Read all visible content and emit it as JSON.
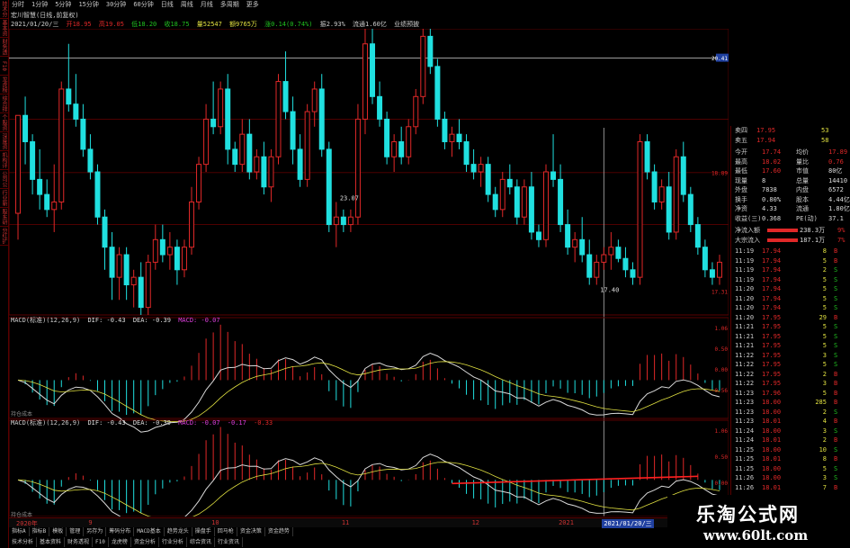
{
  "period_tabs": [
    "分时",
    "1分钟",
    "5分钟",
    "15分钟",
    "30分钟",
    "60分钟",
    "日线",
    "周线",
    "月线",
    "多周期",
    "更多"
  ],
  "left_tabs": [
    "技术分析",
    "基本资料",
    "财务透视",
    "F10",
    "龙虎榜单",
    "综合排名",
    "个股资讯",
    "深度资料",
    "机构评级",
    "公司公告",
    "行业新闻",
    "股东研究",
    "分红扩股"
  ],
  "chart_title": "宏川智慧(日线,前复权)",
  "info_line": {
    "date": "2021/01/20/三",
    "open": "开18.95",
    "high": "高19.05",
    "low": "低18.20",
    "close": "收18.75",
    "volume": "量52547",
    "amount": "额9765万",
    "change": "涨0.14(0.74%)",
    "amplitude": "振2.93%",
    "float": "流通1.60亿",
    "other": "业绩预披"
  },
  "colors": {
    "up": "#e02828",
    "down": "#20e0e0",
    "bg": "#000000",
    "grid": "#5a0000",
    "dif": "#d8d8d8",
    "dea": "#f0f0f0",
    "panel_bg": "#000000"
  },
  "chart_data": [
    {
      "type": "candlestick",
      "name": "price",
      "candles": [
        {
          "o": 18.35,
          "h": 19.5,
          "l": 18.0,
          "c": 19.65
        },
        {
          "o": 19.65,
          "h": 19.9,
          "l": 19.0,
          "c": 19.3
        },
        {
          "o": 19.3,
          "h": 19.4,
          "l": 18.6,
          "c": 18.8
        },
        {
          "o": 18.8,
          "h": 19.2,
          "l": 18.4,
          "c": 18.6
        },
        {
          "o": 18.6,
          "h": 18.8,
          "l": 18.3,
          "c": 18.4
        },
        {
          "o": 18.4,
          "h": 19.0,
          "l": 18.1,
          "c": 18.5
        },
        {
          "o": 18.5,
          "h": 20.1,
          "l": 18.4,
          "c": 20.0
        },
        {
          "o": 20.0,
          "h": 20.6,
          "l": 19.7,
          "c": 19.8
        },
        {
          "o": 19.8,
          "h": 20.2,
          "l": 19.5,
          "c": 19.6
        },
        {
          "o": 19.6,
          "h": 19.8,
          "l": 19.1,
          "c": 19.2
        },
        {
          "o": 19.2,
          "h": 19.4,
          "l": 18.8,
          "c": 18.9
        },
        {
          "o": 18.9,
          "h": 19.0,
          "l": 18.2,
          "c": 18.3
        },
        {
          "o": 18.3,
          "h": 18.4,
          "l": 17.6,
          "c": 17.9
        },
        {
          "o": 17.9,
          "h": 18.1,
          "l": 17.2,
          "c": 17.5
        },
        {
          "o": 17.5,
          "h": 17.9,
          "l": 17.2,
          "c": 17.8
        },
        {
          "o": 17.8,
          "h": 17.9,
          "l": 17.2,
          "c": 17.4
        },
        {
          "o": 17.4,
          "h": 17.6,
          "l": 17.1,
          "c": 17.5
        },
        {
          "o": 17.5,
          "h": 17.7,
          "l": 17.0,
          "c": 17.1
        },
        {
          "o": 17.1,
          "h": 17.8,
          "l": 17.0,
          "c": 17.7
        },
        {
          "o": 17.7,
          "h": 18.2,
          "l": 17.6,
          "c": 18.0
        },
        {
          "o": 18.0,
          "h": 18.2,
          "l": 17.7,
          "c": 17.8
        },
        {
          "o": 17.8,
          "h": 18.1,
          "l": 17.6,
          "c": 17.9
        },
        {
          "o": 17.9,
          "h": 18.0,
          "l": 17.4,
          "c": 17.6
        },
        {
          "o": 17.6,
          "h": 18.0,
          "l": 17.5,
          "c": 17.9
        },
        {
          "o": 17.9,
          "h": 18.7,
          "l": 17.8,
          "c": 18.5
        },
        {
          "o": 18.5,
          "h": 19.1,
          "l": 18.4,
          "c": 19.0
        },
        {
          "o": 19.0,
          "h": 19.8,
          "l": 18.9,
          "c": 19.6
        },
        {
          "o": 19.6,
          "h": 20.1,
          "l": 19.4,
          "c": 19.5
        },
        {
          "o": 19.5,
          "h": 20.1,
          "l": 19.4,
          "c": 20.0
        },
        {
          "o": 20.0,
          "h": 20.2,
          "l": 19.0,
          "c": 19.2
        },
        {
          "o": 19.2,
          "h": 19.3,
          "l": 18.9,
          "c": 19.0
        },
        {
          "o": 19.0,
          "h": 19.6,
          "l": 18.9,
          "c": 19.4
        },
        {
          "o": 19.4,
          "h": 19.6,
          "l": 18.8,
          "c": 18.9
        },
        {
          "o": 18.9,
          "h": 19.2,
          "l": 18.8,
          "c": 19.1
        },
        {
          "o": 19.1,
          "h": 19.3,
          "l": 18.6,
          "c": 18.7
        },
        {
          "o": 18.7,
          "h": 19.2,
          "l": 18.5,
          "c": 19.1
        },
        {
          "o": 19.1,
          "h": 20.2,
          "l": 19.0,
          "c": 20.1
        },
        {
          "o": 20.1,
          "h": 20.5,
          "l": 19.6,
          "c": 19.7
        },
        {
          "o": 19.7,
          "h": 19.9,
          "l": 19.0,
          "c": 19.2
        },
        {
          "o": 19.2,
          "h": 19.4,
          "l": 18.7,
          "c": 18.8
        },
        {
          "o": 18.8,
          "h": 19.8,
          "l": 18.7,
          "c": 19.7
        },
        {
          "o": 19.7,
          "h": 20.1,
          "l": 19.5,
          "c": 20.0
        },
        {
          "o": 20.0,
          "h": 20.2,
          "l": 19.1,
          "c": 19.2
        },
        {
          "o": 19.2,
          "h": 19.3,
          "l": 18.1,
          "c": 18.2
        },
        {
          "o": 18.2,
          "h": 18.5,
          "l": 17.9,
          "c": 18.3
        },
        {
          "o": 18.3,
          "h": 18.4,
          "l": 18.1,
          "c": 18.2
        },
        {
          "o": 18.2,
          "h": 18.4,
          "l": 18.1,
          "c": 18.3
        },
        {
          "o": 18.3,
          "h": 19.8,
          "l": 18.2,
          "c": 19.6
        },
        {
          "o": 19.6,
          "h": 21.0,
          "l": 19.4,
          "c": 20.6
        },
        {
          "o": 20.6,
          "h": 21.2,
          "l": 19.8,
          "c": 19.9
        },
        {
          "o": 19.9,
          "h": 20.1,
          "l": 19.5,
          "c": 19.6
        },
        {
          "o": 19.6,
          "h": 19.7,
          "l": 19.0,
          "c": 19.1
        },
        {
          "o": 19.1,
          "h": 19.4,
          "l": 18.9,
          "c": 19.3
        },
        {
          "o": 19.3,
          "h": 19.5,
          "l": 19.0,
          "c": 19.1
        },
        {
          "o": 19.1,
          "h": 19.6,
          "l": 19.0,
          "c": 19.5
        },
        {
          "o": 19.5,
          "h": 20.0,
          "l": 19.4,
          "c": 19.9
        },
        {
          "o": 19.9,
          "h": 20.9,
          "l": 19.8,
          "c": 20.7
        },
        {
          "o": 20.7,
          "h": 20.8,
          "l": 20.2,
          "c": 20.3
        },
        {
          "o": 20.3,
          "h": 20.4,
          "l": 19.5,
          "c": 19.6
        },
        {
          "o": 19.6,
          "h": 19.7,
          "l": 19.2,
          "c": 19.3
        },
        {
          "o": 19.3,
          "h": 19.5,
          "l": 19.1,
          "c": 19.4
        },
        {
          "o": 19.4,
          "h": 19.6,
          "l": 19.2,
          "c": 19.3
        },
        {
          "o": 19.3,
          "h": 19.4,
          "l": 18.9,
          "c": 19.0
        },
        {
          "o": 19.0,
          "h": 19.2,
          "l": 18.8,
          "c": 18.9
        },
        {
          "o": 18.9,
          "h": 19.1,
          "l": 18.7,
          "c": 19.0
        },
        {
          "o": 19.0,
          "h": 19.1,
          "l": 18.5,
          "c": 18.6
        },
        {
          "o": 18.6,
          "h": 18.7,
          "l": 18.3,
          "c": 18.4
        },
        {
          "o": 18.4,
          "h": 18.9,
          "l": 18.3,
          "c": 18.8
        },
        {
          "o": 18.8,
          "h": 19.0,
          "l": 18.6,
          "c": 18.7
        },
        {
          "o": 18.7,
          "h": 18.8,
          "l": 18.2,
          "c": 18.3
        },
        {
          "o": 18.3,
          "h": 18.8,
          "l": 18.2,
          "c": 18.7
        },
        {
          "o": 18.7,
          "h": 18.9,
          "l": 18.0,
          "c": 18.1
        },
        {
          "o": 18.1,
          "h": 18.2,
          "l": 17.9,
          "c": 18.0
        },
        {
          "o": 18.0,
          "h": 19.0,
          "l": 17.9,
          "c": 18.9
        },
        {
          "o": 18.9,
          "h": 19.4,
          "l": 18.7,
          "c": 18.8
        },
        {
          "o": 18.8,
          "h": 19.0,
          "l": 18.1,
          "c": 18.2
        },
        {
          "o": 18.2,
          "h": 18.4,
          "l": 17.8,
          "c": 17.9
        },
        {
          "o": 17.9,
          "h": 18.1,
          "l": 17.7,
          "c": 18.0
        },
        {
          "o": 18.0,
          "h": 18.3,
          "l": 17.7,
          "c": 17.8
        },
        {
          "o": 17.8,
          "h": 18.0,
          "l": 17.4,
          "c": 17.5
        },
        {
          "o": 17.5,
          "h": 17.8,
          "l": 17.4,
          "c": 17.7
        },
        {
          "o": 17.7,
          "h": 17.9,
          "l": 17.6,
          "c": 17.8
        },
        {
          "o": 17.8,
          "h": 18.1,
          "l": 17.6,
          "c": 17.9
        },
        {
          "o": 17.9,
          "h": 18.0,
          "l": 17.7,
          "c": 17.75
        },
        {
          "o": 17.75,
          "h": 17.9,
          "l": 17.5,
          "c": 17.6
        },
        {
          "o": 17.6,
          "h": 17.7,
          "l": 17.4,
          "c": 17.5
        },
        {
          "o": 17.5,
          "h": 19.4,
          "l": 17.4,
          "c": 19.3
        },
        {
          "o": 19.3,
          "h": 19.4,
          "l": 18.8,
          "c": 18.9
        },
        {
          "o": 18.9,
          "h": 19.0,
          "l": 18.4,
          "c": 18.5
        },
        {
          "o": 18.5,
          "h": 18.8,
          "l": 18.4,
          "c": 18.7
        },
        {
          "o": 18.7,
          "h": 18.9,
          "l": 18.0,
          "c": 18.1
        },
        {
          "o": 18.1,
          "h": 19.2,
          "l": 18.0,
          "c": 19.1
        },
        {
          "o": 19.1,
          "h": 19.3,
          "l": 18.5,
          "c": 18.6
        },
        {
          "o": 18.6,
          "h": 18.7,
          "l": 18.1,
          "c": 18.2
        },
        {
          "o": 18.2,
          "h": 18.3,
          "l": 17.8,
          "c": 17.9
        },
        {
          "o": 17.9,
          "h": 18.0,
          "l": 17.5,
          "c": 17.6
        },
        {
          "o": 17.6,
          "h": 17.7,
          "l": 17.4,
          "c": 17.5
        },
        {
          "o": 17.5,
          "h": 17.8,
          "l": 17.4,
          "c": 17.7
        }
      ],
      "ylim": [
        17.0,
        20.8
      ],
      "markers": [
        {
          "label": "23.07",
          "idx": 44
        },
        {
          "label": "17.40",
          "idx": 80
        }
      ],
      "axis_labels": [
        {
          "label": "20.41",
          "v": 20.41,
          "highlight": true
        },
        {
          "label": "18.89",
          "v": 18.89
        },
        {
          "label": "17.31",
          "v": 17.31
        }
      ],
      "hline": 20.41
    },
    {
      "type": "bar",
      "name": "macd1",
      "label": "MACD(标准)(12,26,9)",
      "dif": "DIF: -0.43",
      "dea": "DEA: -0.39",
      "macd": "MACD: -0.07",
      "ylim": [
        -1.0,
        1.6
      ],
      "ticks": [
        "1.06",
        "0.50",
        "0.00",
        "-0.56"
      ]
    },
    {
      "type": "bar",
      "name": "macd2",
      "label": "MACD(标准)(12,26,9)",
      "dif": "DIF: -0.43",
      "dea": "DEA: -0.39",
      "macd": "MACD: -0.07",
      "extra1": "-0.17",
      "extra2": "-0.33",
      "ylim": [
        -1.0,
        1.6
      ],
      "ticks": [
        "1.06",
        "0.50",
        "0.00"
      ]
    }
  ],
  "x_labels": [
    {
      "label": "2020年",
      "idx": 0
    },
    {
      "label": "9",
      "idx": 10
    },
    {
      "label": "10",
      "idx": 27
    },
    {
      "label": "11",
      "idx": 45
    },
    {
      "label": "12",
      "idx": 63
    },
    {
      "label": "2021",
      "idx": 75
    },
    {
      "label": "2021/01/20/三",
      "idx": 81
    }
  ],
  "macd_notes": [
    "持仓成本",
    "持仓成本"
  ],
  "quote": {
    "sell4": {
      "label": "卖四",
      "price": "17.95",
      "vol": "53"
    },
    "sell5": {
      "label": "卖五",
      "price": "17.94",
      "vol": "58"
    },
    "rows": [
      {
        "l1": "今开",
        "v1": "17.74",
        "l2": "均价",
        "v2": "17.89"
      },
      {
        "l1": "最高",
        "v1": "18.02",
        "l2": "量比",
        "v2": "0.76"
      },
      {
        "l1": "最低",
        "v1": "17.60",
        "l2": "市值",
        "v2": "80亿"
      },
      {
        "l1": "现量",
        "v1": "8",
        "l2": "总量",
        "v2": "14410"
      },
      {
        "l1": "外盘",
        "v1": "7838",
        "l2": "内盘",
        "v2": "6572"
      },
      {
        "l1": "换手",
        "v1": "0.80%",
        "l2": "股本",
        "v2": "4.44亿"
      },
      {
        "l1": "净资",
        "v1": "4.33",
        "l2": "流通",
        "v2": "1.80亿"
      },
      {
        "l1": "收益(三)",
        "v1": "0.368",
        "l2": "PE(动)",
        "v2": "37.1"
      }
    ],
    "inflow": [
      {
        "label": "净流入额",
        "value": "238.3万",
        "pct": "9%"
      },
      {
        "label": "大宗流入",
        "value": "187.1万",
        "pct": "7%"
      }
    ],
    "ticks": [
      {
        "t": "11:19",
        "p": "17.94",
        "v": "8",
        "f": "B"
      },
      {
        "t": "11:19",
        "p": "17.94",
        "v": "5",
        "f": "B"
      },
      {
        "t": "11:19",
        "p": "17.94",
        "v": "2",
        "f": "S"
      },
      {
        "t": "11:19",
        "p": "17.94",
        "v": "5",
        "f": "S"
      },
      {
        "t": "11:20",
        "p": "17.94",
        "v": "5",
        "f": "S"
      },
      {
        "t": "11:20",
        "p": "17.94",
        "v": "5",
        "f": "S"
      },
      {
        "t": "11:20",
        "p": "17.94",
        "v": "5",
        "f": "S"
      },
      {
        "t": "11:20",
        "p": "17.95",
        "v": "29",
        "f": "B"
      },
      {
        "t": "11:21",
        "p": "17.95",
        "v": "5",
        "f": "S"
      },
      {
        "t": "11:21",
        "p": "17.95",
        "v": "5",
        "f": "S"
      },
      {
        "t": "11:21",
        "p": "17.95",
        "v": "5",
        "f": "S"
      },
      {
        "t": "11:22",
        "p": "17.95",
        "v": "3",
        "f": "S"
      },
      {
        "t": "11:22",
        "p": "17.95",
        "v": "5",
        "f": "S"
      },
      {
        "t": "11:22",
        "p": "17.95",
        "v": "2",
        "f": "B"
      },
      {
        "t": "11:22",
        "p": "17.95",
        "v": "3",
        "f": "B"
      },
      {
        "t": "11:23",
        "p": "17.96",
        "v": "5",
        "f": "B"
      },
      {
        "t": "11:23",
        "p": "18.00",
        "v": "285",
        "f": "B"
      },
      {
        "t": "11:23",
        "p": "18.00",
        "v": "2",
        "f": "S"
      },
      {
        "t": "11:23",
        "p": "18.01",
        "v": "4",
        "f": "B"
      },
      {
        "t": "11:24",
        "p": "18.00",
        "v": "3",
        "f": "S"
      },
      {
        "t": "11:24",
        "p": "18.01",
        "v": "2",
        "f": "B"
      },
      {
        "t": "11:25",
        "p": "18.00",
        "v": "10",
        "f": "S"
      },
      {
        "t": "11:25",
        "p": "18.01",
        "v": "8",
        "f": "B"
      },
      {
        "t": "11:25",
        "p": "18.00",
        "v": "5",
        "f": "S"
      },
      {
        "t": "11:26",
        "p": "18.00",
        "v": "3",
        "f": "S"
      },
      {
        "t": "11:26",
        "p": "18.01",
        "v": "7",
        "f": "B"
      }
    ]
  },
  "indicator_tabs": [
    "指标A",
    "指标B",
    "模板",
    "管理",
    "另存为",
    "筹码分布",
    "MACD基本",
    "趋势龙头",
    "操盘手",
    "回马枪",
    "资金决策",
    "资金趋势"
  ],
  "bottom_tabs": [
    "技术分析",
    "基本资料",
    "财务透视",
    "F10",
    "龙虎榜",
    "资金分析",
    "行业分析",
    "综合资讯",
    "行业资讯"
  ],
  "watermark": {
    "title": "乐淘公式网",
    "url": "www.60lt.com"
  }
}
